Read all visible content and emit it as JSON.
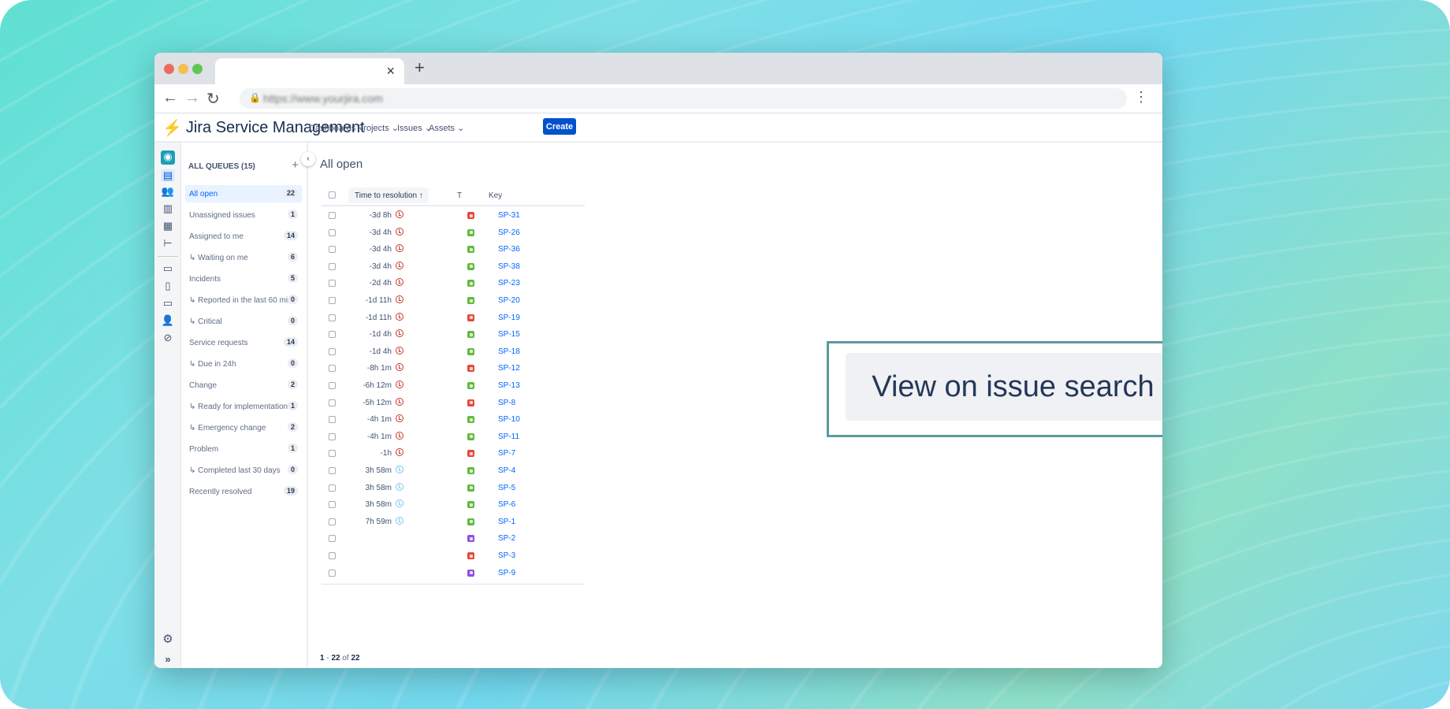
{
  "browser": {
    "url": "https://www.yourjira.com",
    "tab_close": "×",
    "new_tab": "+"
  },
  "header": {
    "product": "Jira Service Management",
    "nav": [
      "Dashboards",
      "Projects",
      "Issues",
      "Assets"
    ],
    "create": "Create"
  },
  "queues": {
    "heading": "ALL QUEUES (15)",
    "items": [
      {
        "label": "All open",
        "count": "22",
        "active": true
      },
      {
        "label": "Unassigned issues",
        "count": "1"
      },
      {
        "label": "Assigned to me",
        "count": "14"
      },
      {
        "label": "↳ Waiting on me",
        "count": "6"
      },
      {
        "label": "Incidents",
        "count": "5"
      },
      {
        "label": "↳ Reported in the last 60 mi...",
        "count": "0"
      },
      {
        "label": "↳ Critical",
        "count": "0"
      },
      {
        "label": "Service requests",
        "count": "14"
      },
      {
        "label": "↳ Due in 24h",
        "count": "0"
      },
      {
        "label": "Change",
        "count": "2"
      },
      {
        "label": "↳ Ready for implementation",
        "count": "1"
      },
      {
        "label": "↳ Emergency change",
        "count": "2"
      },
      {
        "label": "Problem",
        "count": "1"
      },
      {
        "label": "↳ Completed last 30 days",
        "count": "0"
      },
      {
        "label": "Recently resolved",
        "count": "19"
      }
    ]
  },
  "main": {
    "title": "All open",
    "columns": {
      "time": "Time to resolution ↑",
      "type": "T",
      "key": "Key"
    },
    "rows": [
      {
        "time": "-3d 8h",
        "status": "breached",
        "type": "incident",
        "key": "SP-31"
      },
      {
        "time": "-3d 4h",
        "status": "breached",
        "type": "request",
        "key": "SP-26"
      },
      {
        "time": "-3d 4h",
        "status": "breached",
        "type": "request",
        "key": "SP-36"
      },
      {
        "time": "-3d 4h",
        "status": "breached",
        "type": "request",
        "key": "SP-38"
      },
      {
        "time": "-2d 4h",
        "status": "breached",
        "type": "request",
        "key": "SP-23"
      },
      {
        "time": "-1d 11h",
        "status": "breached",
        "type": "request",
        "key": "SP-20"
      },
      {
        "time": "-1d 11h",
        "status": "breached",
        "type": "incident",
        "key": "SP-19"
      },
      {
        "time": "-1d 4h",
        "status": "breached",
        "type": "request",
        "key": "SP-15"
      },
      {
        "time": "-1d 4h",
        "status": "breached",
        "type": "request",
        "key": "SP-18"
      },
      {
        "time": "-8h 1m",
        "status": "breached",
        "type": "incident",
        "key": "SP-12"
      },
      {
        "time": "-6h 12m",
        "status": "breached",
        "type": "request",
        "key": "SP-13"
      },
      {
        "time": "-5h 12m",
        "status": "breached",
        "type": "incident",
        "key": "SP-8"
      },
      {
        "time": "-4h 1m",
        "status": "breached",
        "type": "request",
        "key": "SP-10"
      },
      {
        "time": "-4h 1m",
        "status": "breached",
        "type": "request",
        "key": "SP-11"
      },
      {
        "time": "-1h",
        "status": "breached",
        "type": "incident",
        "key": "SP-7"
      },
      {
        "time": "3h 58m",
        "status": "ok",
        "type": "request",
        "key": "SP-4"
      },
      {
        "time": "3h 58m",
        "status": "ok",
        "type": "request",
        "key": "SP-5"
      },
      {
        "time": "3h 58m",
        "status": "ok",
        "type": "request",
        "key": "SP-6"
      },
      {
        "time": "7h 59m",
        "status": "ok",
        "type": "request",
        "key": "SP-1"
      },
      {
        "time": "",
        "status": "",
        "type": "change",
        "key": "SP-2"
      },
      {
        "time": "",
        "status": "",
        "type": "problem",
        "key": "SP-3"
      },
      {
        "time": "",
        "status": "",
        "type": "change",
        "key": "SP-9"
      }
    ],
    "pager": {
      "from": "1",
      "sep": " - ",
      "to": "22",
      "of": " of ",
      "total": "22"
    }
  },
  "overlay": {
    "button": "View on issue search"
  },
  "colors": {
    "incident": "#e5493a",
    "request": "#63ba3c",
    "change": "#904ee2",
    "problem": "#e5493a",
    "breached": "#c9372c",
    "ok": "#79c7ee",
    "accent": "#0052cc"
  }
}
